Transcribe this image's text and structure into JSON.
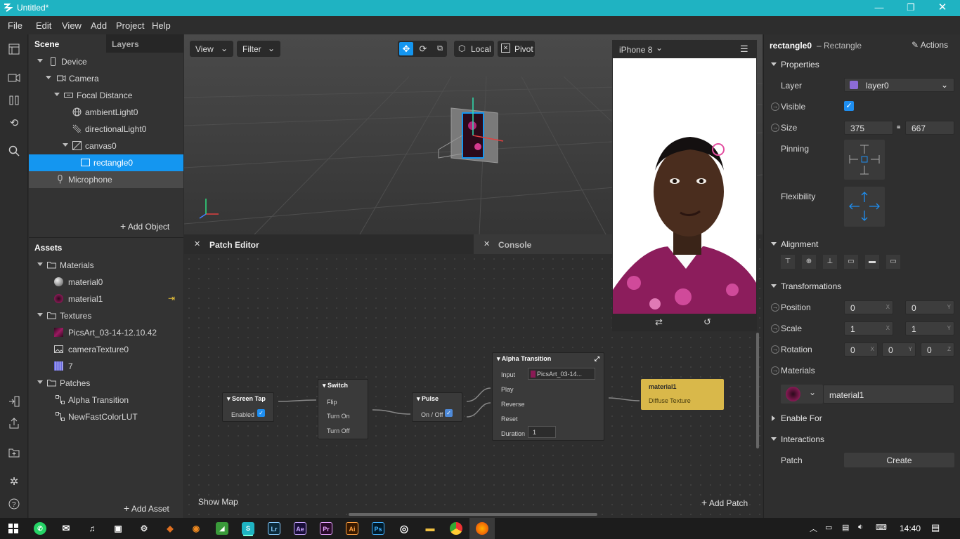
{
  "window": {
    "title": "Untitled*"
  },
  "menu": [
    "File",
    "Edit",
    "View",
    "Add",
    "Project",
    "Help"
  ],
  "scene": {
    "tabs": [
      "Scene",
      "Layers"
    ],
    "tree": [
      {
        "label": "Device",
        "icon": "phone-icon"
      },
      {
        "label": "Camera",
        "icon": "camera-icon"
      },
      {
        "label": "Focal Distance",
        "icon": "focal-distance-icon"
      },
      {
        "label": "ambientLight0",
        "icon": "ambient-light-icon"
      },
      {
        "label": "directionalLight0",
        "icon": "directional-light-icon"
      },
      {
        "label": "canvas0",
        "icon": "canvas-icon"
      },
      {
        "label": "rectangle0",
        "icon": "rectangle-icon"
      },
      {
        "label": "Microphone",
        "icon": "microphone-icon"
      }
    ],
    "add_object": "Add Object"
  },
  "assets": {
    "title": "Assets",
    "tree": [
      {
        "label": "Materials",
        "icon": "folder-icon"
      },
      {
        "label": "material0",
        "icon": "material-sphere-icon"
      },
      {
        "label": "material1",
        "icon": "material-thumbnail-icon"
      },
      {
        "label": "Textures",
        "icon": "folder-icon"
      },
      {
        "label": "PicsArt_03-14-12.10.42",
        "icon": "texture-thumbnail-icon"
      },
      {
        "label": "cameraTexture0",
        "icon": "image-icon"
      },
      {
        "label": "7",
        "icon": "lut-grid-icon"
      },
      {
        "label": "Patches",
        "icon": "folder-icon"
      },
      {
        "label": "Alpha Transition",
        "icon": "patch-icon"
      },
      {
        "label": "NewFastColorLUT",
        "icon": "patch-icon"
      }
    ],
    "add_asset": "Add Asset"
  },
  "viewport": {
    "view_label": "View",
    "filter_label": "Filter",
    "local_label": "Local",
    "pivot_label": "Pivot"
  },
  "preview": {
    "device": "iPhone 8"
  },
  "patch_editor": {
    "tab": "Patch Editor",
    "console_tab": "Console",
    "show_map": "Show Map",
    "add_patch": "Add Patch",
    "nodes": {
      "screen_tap": {
        "title": "Screen Tap",
        "enabled": "Enabled"
      },
      "switch": {
        "title": "Switch",
        "flip": "Flip",
        "turn_on": "Turn On",
        "turn_off": "Turn Off"
      },
      "pulse": {
        "title": "Pulse",
        "onoff": "On / Off"
      },
      "alpha": {
        "title": "Alpha Transition",
        "input": "Input",
        "input_value": "PicsArt_03-14...",
        "play": "Play",
        "reverse": "Reverse",
        "reset": "Reset",
        "duration": "Duration",
        "duration_value": "1"
      },
      "material": {
        "title": "material1",
        "port": "Diffuse Texture"
      }
    }
  },
  "properties": {
    "object_name": "rectangle0",
    "object_type": "– Rectangle",
    "actions": "Actions",
    "section_properties": "Properties",
    "layer_label": "Layer",
    "layer_value": "layer0",
    "visible_label": "Visible",
    "size_label": "Size",
    "width": "375",
    "height": "667",
    "pinning_label": "Pinning",
    "flexibility_label": "Flexibility",
    "section_alignment": "Alignment",
    "section_transformations": "Transformations",
    "position_label": "Position",
    "position": [
      "0",
      "0"
    ],
    "scale_label": "Scale",
    "scale": [
      "1",
      "1"
    ],
    "rotation_label": "Rotation",
    "rotation": [
      "0",
      "0",
      "0"
    ],
    "section_materials": "Materials",
    "material_value": "material1",
    "section_enable_for": "Enable For",
    "section_interactions": "Interactions",
    "patch_label": "Patch",
    "create_button": "Create",
    "axes": [
      "X",
      "Y",
      "Z"
    ]
  },
  "taskbar": {
    "apps": [
      "Lr",
      "Ae",
      "Pr",
      "Ai",
      "Ps"
    ],
    "time": "14:40"
  },
  "colors": {
    "accent": "#1496f0",
    "titlebar": "#1fb3c2",
    "material_node": "#d9b84a"
  }
}
